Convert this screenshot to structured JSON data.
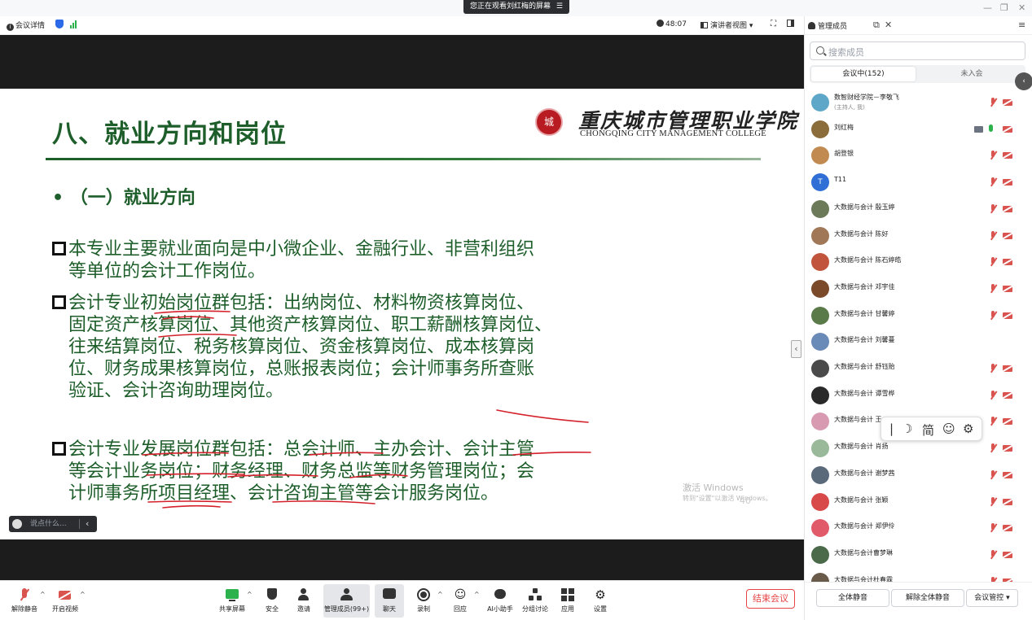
{
  "banner": {
    "text": "您正在观看刘红梅的屏幕",
    "icon": "menu-icon"
  },
  "window_controls": {
    "minimize": "—",
    "restore": "❐",
    "close": "✕"
  },
  "topbar": {
    "meeting_info": "会议详情",
    "timer": "48:07",
    "view_mode": "演讲者视图",
    "manage_members": "管理成员"
  },
  "slide": {
    "title": "八、就业方向和岗位",
    "logo_cn": "重庆城市管理职业学院",
    "logo_en": "CHONGQING CITY MANAGEMENT COLLEGE",
    "seal_text": "城",
    "subheading": "• （一）就业方向",
    "p1_line1": "本专业主要就业面向是中小微企业、金融行业、非营利组织",
    "p1_line2": "等单位的会计工作岗位。",
    "p2_line1": "会计专业初始岗位群包括：出纳岗位、材料物资核算岗位、",
    "p2_line2": "固定资产核算岗位、其他资产核算岗位、职工薪酬核算岗位、",
    "p2_line3": "往来结算岗位、税务核算岗位、资金核算岗位、成本核算岗",
    "p2_line4": "位、财务成果核算岗位，总账报表岗位；会计师事务所查账",
    "p2_line5": "验证、会计咨询助理岗位。",
    "p3_line1": "会计专业发展岗位群包括：总会计师、主办会计、会计主管",
    "p3_line2": "等会计业务岗位；财务经理、财务总监等财务管理岗位；会",
    "p3_line3": "计师事务所项目经理、会计咨询主管等会计服务岗位。",
    "watermark_line1": "激活 Windows",
    "watermark_line2": "转到\"设置\"以激活 Windows。",
    "page_number": "40",
    "accent_color": "#1d5e2a"
  },
  "chat_input": {
    "placeholder": "说点什么..."
  },
  "ime_toolbar": {
    "items": [
      "|",
      "☽",
      "简",
      "☺",
      "⚙"
    ]
  },
  "toolbar": {
    "unmute": "解除静音",
    "start_video": "开启视频",
    "share_screen": "共享屏幕",
    "security": "安全",
    "invite": "邀请",
    "manage_members": "管理成员(99+)",
    "chat": "聊天",
    "record": "录制",
    "react": "回应",
    "ai_assistant": "AI小助手",
    "breakout": "分组讨论",
    "apps": "应用",
    "settings": "设置",
    "end_meeting": "结束会议"
  },
  "panel": {
    "search_placeholder": "搜索成员",
    "tab_in_meeting": "会议中(152)",
    "tab_not_joined": "未入会",
    "participants": [
      {
        "name": "数智财经学院－李敬飞",
        "sub": "(主持人, 我)",
        "color": "#5fa7c9"
      },
      {
        "name": "刘红梅",
        "sub": "",
        "color": "#8a6d3b"
      },
      {
        "name": "胡登银",
        "sub": "",
        "color": "#c08a50"
      },
      {
        "name": "T11",
        "sub": "",
        "color": "#2f6fd6",
        "initial": "T"
      },
      {
        "name": "大数据与会计 殷玉婷",
        "sub": "",
        "color": "#6c7a5a"
      },
      {
        "name": "大数据与会计 陈好",
        "sub": "",
        "color": "#a07858"
      },
      {
        "name": "大数据与会计 陈石婷皓",
        "sub": "",
        "color": "#c0543c"
      },
      {
        "name": "大数据与会计 邓宇佳",
        "sub": "",
        "color": "#7a4a2a"
      },
      {
        "name": "大数据与会计 甘馨婷",
        "sub": "",
        "color": "#5a7a4a"
      },
      {
        "name": "大数据与会计 刘馨蔓",
        "sub": "",
        "color": "#6a8ab8"
      },
      {
        "name": "大数据与会计 舒钰贻",
        "sub": "",
        "color": "#4a4a4a"
      },
      {
        "name": "大数据与会计 谭雪桦",
        "sub": "",
        "color": "#2a2a2a"
      },
      {
        "name": "大数据与会计 王",
        "sub": "",
        "color": "#d89ab0"
      },
      {
        "name": "大数据与会计 肖扬",
        "sub": "",
        "color": "#9ab89a"
      },
      {
        "name": "大数据与会计 谢梦茜",
        "sub": "",
        "color": "#5a6a7a"
      },
      {
        "name": "大数据与会计 张颖",
        "sub": "",
        "color": "#d84a4a"
      },
      {
        "name": "大数据与会计 郑伊伶",
        "sub": "",
        "color": "#e05a6a"
      },
      {
        "name": "大数据与会计曹梦琳",
        "sub": "",
        "color": "#4a6a4a"
      },
      {
        "name": "大数据与会计杜春霖",
        "sub": "",
        "color": "#6a5a4a"
      }
    ],
    "mute_all": "全体静音",
    "unmute_all": "解除全体静音",
    "meeting_control": "会议管控"
  }
}
